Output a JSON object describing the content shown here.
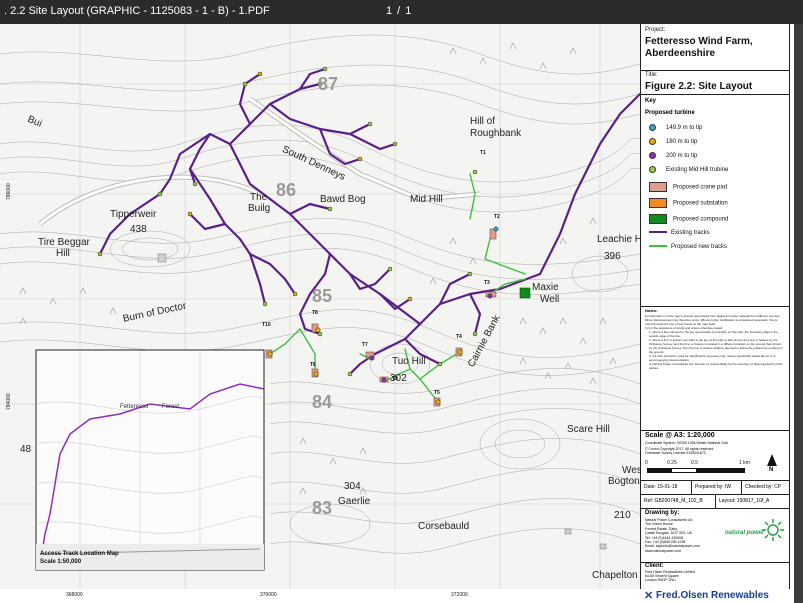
{
  "viewer": {
    "doc_title": ". 2.2 Site Layout (GRAPHIC - 1125083 - 1 - B) - 1.PDF",
    "page_count": "1 / 1"
  },
  "map": {
    "place_names": [
      {
        "text": "Hill of",
        "k": "hn"
      },
      {
        "text": "Roughbank",
        "k": "hn"
      },
      {
        "text": "South Denneys",
        "k": "hn"
      },
      {
        "text": "The",
        "k": "hn"
      },
      {
        "text": "Builg",
        "k": "hn"
      },
      {
        "text": "Bawd Bog",
        "k": "hn"
      },
      {
        "text": "Mid Hill",
        "k": "hn"
      },
      {
        "text": "Tipperweir",
        "k": "hn"
      },
      {
        "text": "Tire Beggar",
        "k": "hn"
      },
      {
        "text": "Hill",
        "k": "hn"
      },
      {
        "text": "Leachie Hill",
        "k": "hn"
      },
      {
        "text": "Tuo Hill",
        "k": "hn"
      },
      {
        "text": "Scare Hill",
        "k": "hn"
      },
      {
        "text": "Gaerlie",
        "k": "hn"
      },
      {
        "text": "Corsebauld",
        "k": "hn"
      },
      {
        "text": "West",
        "k": "hn"
      },
      {
        "text": "Bogton",
        "k": "hn"
      },
      {
        "text": "Chapelton",
        "k": "hn"
      },
      {
        "text": "Maxie",
        "k": "hn"
      },
      {
        "text": "Well",
        "k": "hn"
      },
      {
        "text": "Cairnie Bank",
        "k": "hn"
      },
      {
        "text": "Burn of Doctor",
        "k": "hn"
      },
      {
        "text": "Bui",
        "k": "hn"
      }
    ],
    "spot_heights": [
      "438",
      "396",
      "302",
      "304",
      "210",
      "48"
    ],
    "grid_numbers": [
      "87",
      "86",
      "85",
      "84",
      "83"
    ],
    "turbine_labels": [
      "T1",
      "T2",
      "T3",
      "T4",
      "T5",
      "T6",
      "T7",
      "T8",
      "T9",
      "T10"
    ],
    "axis_labels": {
      "x": [
        "368000",
        "370000",
        "372000"
      ],
      "y": [
        "786000",
        "784000"
      ]
    },
    "inset": {
      "title": "Access Track Location Map",
      "scale": "Scale 1:50,000",
      "labels": [
        "Fetteresso",
        "Forest"
      ]
    }
  },
  "panel": {
    "project_label": "Project:",
    "project_name": "Fetteresso Wind Farm, Aberdeenshire",
    "title_label": "Title:",
    "title": "Figure 2.2: Site Layout",
    "key_title": "Key",
    "key_subtitle": "Proposed turbine",
    "key_items": [
      {
        "label": "149.9 m to tip",
        "kind": "dot",
        "color": "#2fa6d6"
      },
      {
        "label": "180 m to tip",
        "kind": "dot",
        "color": "#e8b000"
      },
      {
        "label": "200 m to tip",
        "kind": "dot",
        "color": "#8f2fb5"
      },
      {
        "label": "Existing Mid Hill trubine",
        "kind": "dot",
        "color": "#9ccf45"
      },
      {
        "label": "Proposed crane pad",
        "kind": "swatch",
        "color": "#d9a08e"
      },
      {
        "label": "Proposed substation",
        "kind": "swatch",
        "color": "#f28c1a"
      },
      {
        "label": "Proposed compound",
        "kind": "swatch",
        "color": "#138a1e"
      },
      {
        "label": "Existing tracks",
        "kind": "line",
        "color": "#5b1f88"
      },
      {
        "label": "Proposed new tracks",
        "kind": "line",
        "color": "#3fbf3f"
      }
    ],
    "notes_title": "Notes:",
    "notes": [
      "a) Information on this map is directly reproduced from digital and other material from different sources. Minor discrepancies may therefore occur. Where further clarification is considered necessary, this is noted through the use of text boxes on the map itself.",
      "b) For the avoidance of doubt and unless otherwise stated:",
      "1. where a line coloured in the key demarcates a boundary on this plan, the boundary edge is the outside edge of the line.",
      "2. where a line or feature recorded in the key of this plan is also shown as a line or feature by the Ordnance Survey, and that line or feature is located in a different position on the ground than shown by the Ordnance Survey, then the line or feature shall be deemed to follow the position as existing on the ground.",
      "3. the plan should be used for identification purposes only, unless specifically stated above or in accompanying documentation.",
      "4. Natural Power Consultants Ltd. accepts no responsibility for the accuracy of data supplied by third parties."
    ],
    "scale_title": "Scale @ A3: 1:20,000",
    "coord_system": "Coordinate System: OSGB 1936 British National Grid",
    "copyright": [
      "© Crown Copyright 2017. All rights reserved.",
      "Ordnance Survey Licence 0100031673"
    ],
    "scale_ticks": [
      "0",
      "0.25",
      "0.5",
      "1 km"
    ],
    "north": "N",
    "date": "Date: 15-01-18",
    "prepared_by": "Prepared by: IW",
    "checked_by": "Checked by: CP",
    "ref": "Ref: GB200748_M_102_B",
    "layout": "Layout: 150817_10f_A",
    "drawing_by_label": "Drawing by:",
    "drawing_by_lines": [
      "Natural Power Consultants Ltd",
      "The Green House",
      "Forrest Estate, Dalry,",
      "Castle Douglas, DG7 3XS, UK",
      "Tel: +44 (0)1644 430008",
      "Fax: +44 (0)845 299 1236",
      "Email: sayhello@naturalpower.com",
      "www.naturalpower.com"
    ],
    "np_logo": "natural power",
    "client_label": "Client:",
    "client_lines": [
      "Fred.Olsen Renewables Limited",
      "64-65 Vincent Square",
      "London SW1P 2NU"
    ],
    "fo_logo": "Fred.Olsen Renewables"
  },
  "colors": {
    "existing_track": "#5b1f88",
    "new_track": "#3fbf3f",
    "contour": "#9a9a9a",
    "road": "#c8c8c8",
    "brand_blue": "#1a3e8c",
    "np_green": "#2e9e4a"
  }
}
